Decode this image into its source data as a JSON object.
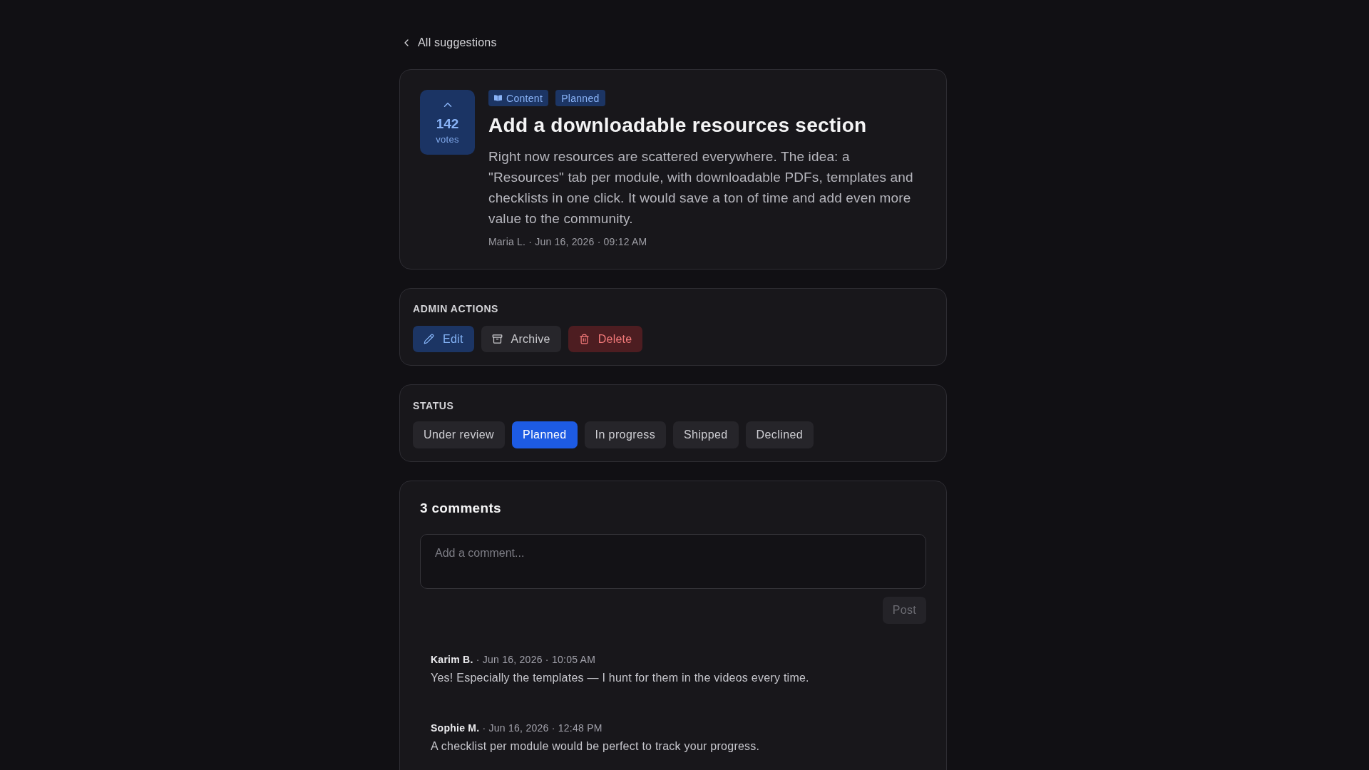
{
  "back_link": {
    "label": "All suggestions"
  },
  "suggestion": {
    "votes": {
      "count": "142",
      "label": "votes",
      "voted": true
    },
    "tags": [
      {
        "kind": "category",
        "label": "Content"
      },
      {
        "kind": "status",
        "label": "Planned"
      }
    ],
    "title": "Add a downloadable resources section",
    "description": "Right now resources are scattered everywhere. The idea: a \"Resources\" tab per module, with downloadable PDFs, templates and checklists in one click. It would save a ton of time and add even more value to the community.",
    "meta": "Maria L. · Jun 16, 2026 · 09:12 AM"
  },
  "admin_actions": {
    "heading": "ADMIN ACTIONS",
    "buttons": [
      {
        "kind": "edit",
        "label": "Edit"
      },
      {
        "kind": "archive",
        "label": "Archive"
      },
      {
        "kind": "delete",
        "label": "Delete"
      }
    ]
  },
  "status": {
    "heading": "STATUS",
    "options": [
      {
        "label": "Under review",
        "selected": false
      },
      {
        "label": "Planned",
        "selected": true
      },
      {
        "label": "In progress",
        "selected": false
      },
      {
        "label": "Shipped",
        "selected": false
      },
      {
        "label": "Declined",
        "selected": false
      }
    ]
  },
  "comments": {
    "heading": "3 comments",
    "input": {
      "placeholder": "Add a comment..."
    },
    "post_button": {
      "label": "Post",
      "disabled": true
    },
    "items": [
      {
        "meta": "**Karim B.** · Jun 16, 2026 · 10:05 AM",
        "text": "Yes! Especially the templates — I hunt for them in the videos every time."
      },
      {
        "meta": "**Sophie M.** · Jun 16, 2026 · 12:48 PM",
        "text": "A checklist per module would be perfect to track your progress."
      }
    ]
  }
}
